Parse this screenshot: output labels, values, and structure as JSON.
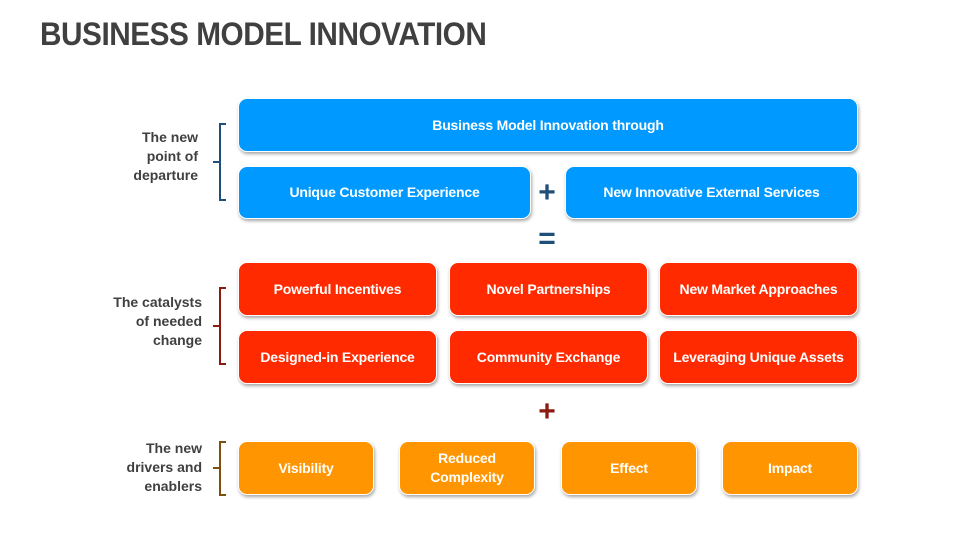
{
  "title": "BUSINESS MODEL INNOVATION",
  "colors": {
    "blue": "#0099ff",
    "red": "#ff2a00",
    "orange": "#ff9500",
    "bracket_blue": "#1f4e79",
    "bracket_red": "#8b1a10",
    "bracket_orange": "#7f4f10",
    "plus_blue": "#1f4e79",
    "plus_red": "#8b1a10",
    "label_text": "#404040"
  },
  "sections": {
    "departure": {
      "label": "The new point of departure",
      "label_lines": [
        "The new",
        "point of",
        "departure"
      ],
      "header": "Business Model Innovation through",
      "left": "Unique Customer Experience",
      "operator_between": "+",
      "right": "New Innovative External Services",
      "operator_after": "="
    },
    "catalysts": {
      "label": "The catalysts of needed change",
      "label_lines": [
        "The catalysts",
        "of needed",
        "change"
      ],
      "items": [
        "Powerful Incentives",
        "Novel Partnerships",
        "New Market Approaches",
        "Designed-in Experience",
        "Community Exchange",
        "Leveraging Unique Assets"
      ],
      "operator_after": "+"
    },
    "drivers": {
      "label": "The new drivers and enablers",
      "label_lines": [
        "The new",
        "drivers and",
        "enablers"
      ],
      "items": [
        "Visibility",
        "Reduced Complexity",
        "Effect",
        "Impact"
      ]
    }
  }
}
